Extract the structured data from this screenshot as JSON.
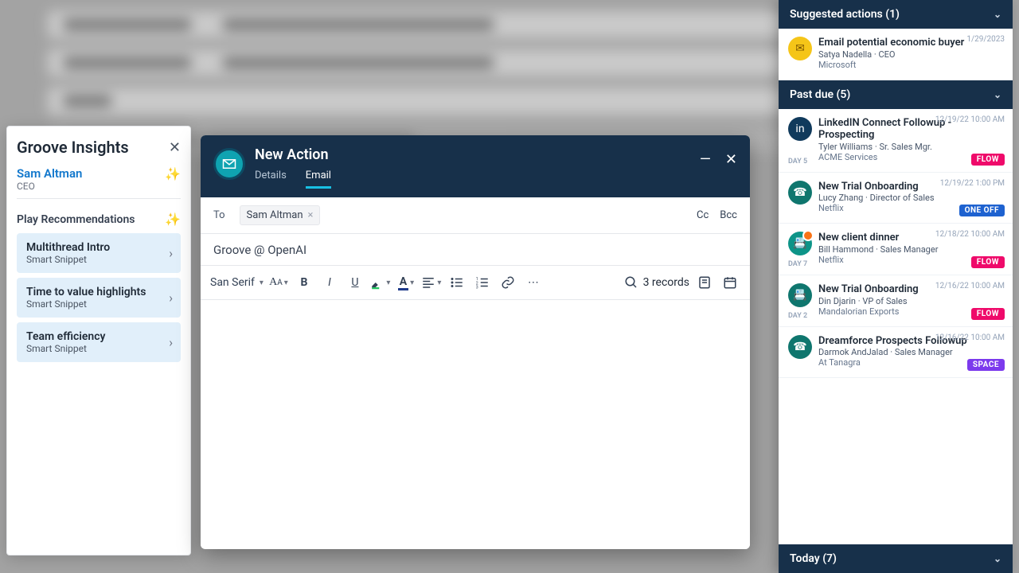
{
  "insights": {
    "title": "Groove Insights",
    "contact": {
      "name": "Sam Altman",
      "role": "CEO"
    },
    "section_label": "Play Recommendations",
    "plays": [
      {
        "title": "Multithread Intro",
        "sub": "Smart Snippet"
      },
      {
        "title": "Time to value highlights",
        "sub": "Smart Snippet"
      },
      {
        "title": "Team efficiency",
        "sub": "Smart Snippet"
      }
    ]
  },
  "compose": {
    "title": "New Action",
    "tabs": {
      "details": "Details",
      "email": "Email"
    },
    "to_label": "To",
    "recipient": "Sam Altman",
    "cc": "Cc",
    "bcc": "Bcc",
    "subject": "Groove @ OpenAI",
    "font": "San Serif",
    "records": "3 records"
  },
  "rightcol": {
    "suggested_header": "Suggested actions (1)",
    "suggested": {
      "title": "Email potential economic buyer",
      "person": "Satya Nadella · CEO",
      "company": "Microsoft",
      "date": "1/29/2023"
    },
    "pastdue_header": "Past due (5)",
    "pastdue": [
      {
        "title": "LinkedIN Connect Followup - Prospecting",
        "person": "Tyler Williams · Sr. Sales Mgr.",
        "company": "ACME Services",
        "date": "12/19/22 10:00 AM",
        "day": "DAY 5",
        "tag": "FLOW",
        "tagClass": "flow",
        "bullet": "darkblue",
        "glyph": "in"
      },
      {
        "title": "New Trial Onboarding",
        "person": "Lucy Zhang · Director of Sales",
        "company": "Netflix",
        "date": "12/19/22 1:00 PM",
        "day": "",
        "tag": "ONE OFF",
        "tagClass": "oneoff",
        "bullet": "teal",
        "glyph": "☎"
      },
      {
        "title": "New client dinner",
        "person": "Bill Hammond · Sales Manager",
        "company": "Netflix",
        "date": "12/18/22 10:00 AM",
        "day": "DAY 7",
        "tag": "FLOW",
        "tagClass": "flow",
        "bullet": "teal2",
        "glyph": "📇"
      },
      {
        "title": "New Trial Onboarding",
        "person": "Din Djarin · VP of Sales",
        "company": "Mandalorian Exports",
        "date": "12/16/22 10:00 AM",
        "day": "DAY 2",
        "tag": "FLOW",
        "tagClass": "flow",
        "bullet": "teal",
        "glyph": "📇"
      },
      {
        "title": "Dreamforce Prospects Followup",
        "person": "Darmok AndJalad · Sales Manager",
        "company": "At Tanagra",
        "date": "12/16/22 10:00 AM",
        "day": "",
        "tag": "SPACE",
        "tagClass": "space",
        "bullet": "teal",
        "glyph": "☎"
      }
    ],
    "today_header": "Today (7)"
  }
}
